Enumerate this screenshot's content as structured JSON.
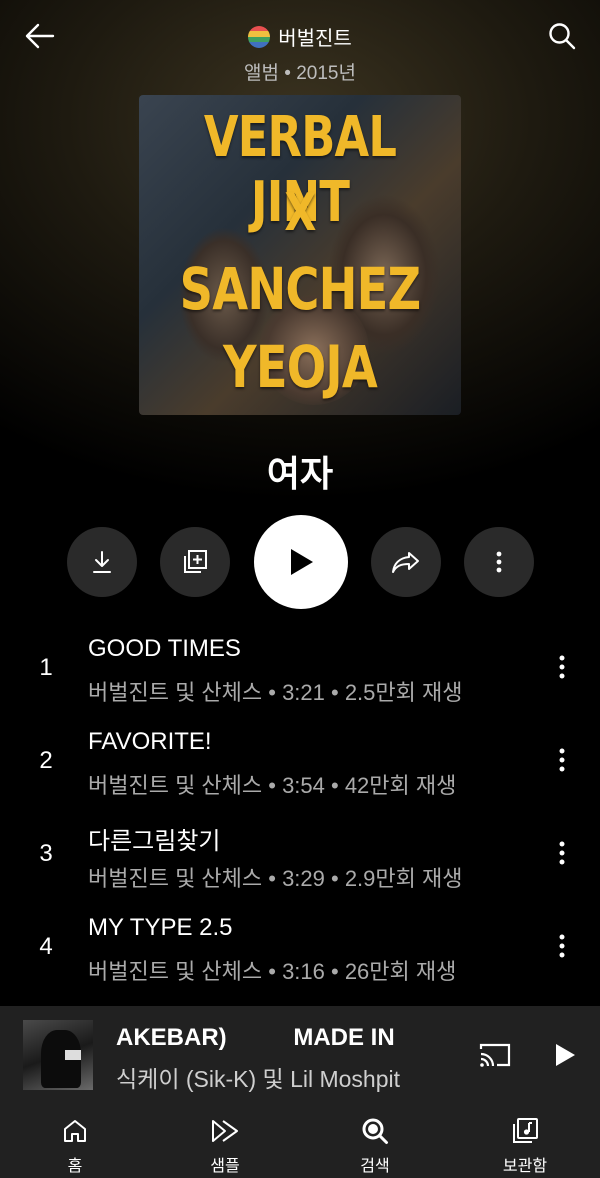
{
  "header": {
    "artist": "버벌진트",
    "subtitle": "앨범 • 2015년"
  },
  "cover_text": {
    "line1": "VERBAL JINT",
    "line2": "X",
    "line3": "SANCHEZ",
    "line4": "YEOJA"
  },
  "album": {
    "title": "여자"
  },
  "tracks": [
    {
      "num": "1",
      "title": "GOOD TIMES",
      "meta": "버벌진트 및 산체스 • 3:21 • 2.5만회 재생"
    },
    {
      "num": "2",
      "title": "FAVORITE!",
      "meta": "버벌진트 및 산체스 • 3:54 • 42만회 재생"
    },
    {
      "num": "3",
      "title": "다른그림찾기",
      "meta": "버벌진트 및 산체스 • 3:29 • 2.9만회 재생"
    },
    {
      "num": "4",
      "title": "MY TYPE 2.5",
      "meta": "버벌진트 및 산체스 • 3:16 • 26만회 재생"
    }
  ],
  "mini_player": {
    "title": "AKEBAR)          MADE IN",
    "artists": "식케이 (Sik-K) 및 Lil Moshpit"
  },
  "nav": [
    {
      "label": "홈",
      "icon": "home-icon"
    },
    {
      "label": "샘플",
      "icon": "samples-icon"
    },
    {
      "label": "검색",
      "icon": "search-icon"
    },
    {
      "label": "보관함",
      "icon": "library-icon"
    }
  ],
  "colors": {
    "background": "#000000",
    "cover_text": "#f0b829",
    "action_button_bg": "#2a2a2a",
    "mini_player_bg": "#212121",
    "secondary_text": "#aaaaaa"
  }
}
